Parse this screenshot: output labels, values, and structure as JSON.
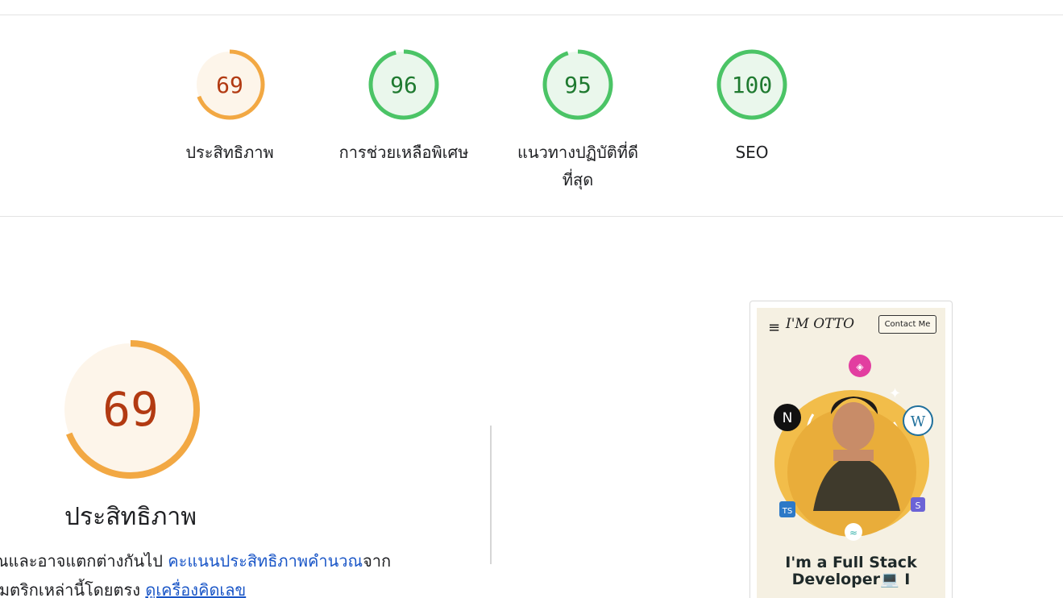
{
  "scores": [
    {
      "value": "69",
      "fraction": 0.69,
      "label": "ประสิทธิภาพ",
      "color": "#f2a843",
      "bg": "#fdf5ea",
      "text": "#b23a12"
    },
    {
      "value": "96",
      "fraction": 0.96,
      "label": "การช่วยเหลือพิเศษ",
      "color": "#4bc466",
      "bg": "#eaf7ec",
      "text": "#1f7a30"
    },
    {
      "value": "95",
      "fraction": 0.95,
      "label": "แนวทางปฏิบัติที่ดีที่สุด",
      "color": "#4bc466",
      "bg": "#eaf7ec",
      "text": "#1f7a30"
    },
    {
      "value": "100",
      "fraction": 1.0,
      "label": "SEO",
      "color": "#4bc466",
      "bg": "#eaf7ec",
      "text": "#1f7a30"
    }
  ],
  "performance": {
    "score": "69",
    "fraction": 0.69,
    "title": "ประสิทธิภาพ",
    "line1_text": "ณและอาจแตกต่างกันไป ",
    "line1_link": "คะแนนประสิทธิภาพคำนวณ",
    "line1_tail": "จาก",
    "line2_text": " เมตริกเหล่านี้โดยตรง ",
    "line2_link": "ดูเครื่องคิดเลข"
  },
  "thumbnail": {
    "menu_icon": "≡",
    "logo": "I'M OTTO",
    "contact_button": "Contact Me",
    "headline_line1": "I'm a Full Stack",
    "headline_line2": "Developer💻 I"
  }
}
